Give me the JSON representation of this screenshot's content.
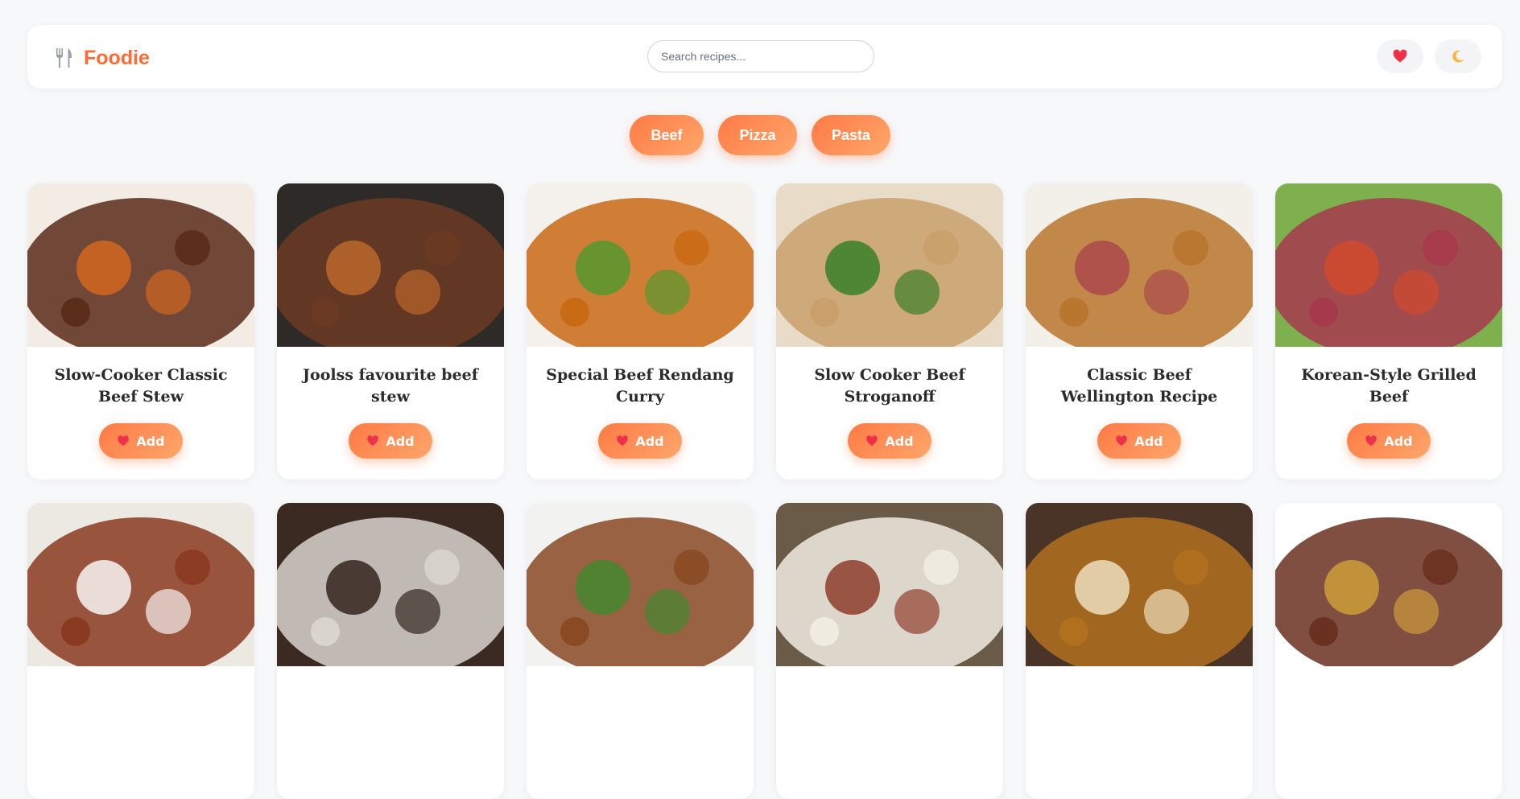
{
  "brand": {
    "name": "Foodie",
    "icon": "fork-knife-icon",
    "color": "#ff6b35"
  },
  "search": {
    "placeholder": "Search recipes..."
  },
  "header_actions": [
    {
      "name": "favorites",
      "icon": "heart-icon",
      "color": "#f0304a"
    },
    {
      "name": "theme-toggle",
      "icon": "moon-icon",
      "color": "#f5b942"
    }
  ],
  "categories": [
    "Beef",
    "Pizza",
    "Pasta"
  ],
  "accent": {
    "gradient_start": "#ff7a45",
    "gradient_end": "#ffa66b",
    "heart": "#f0304a"
  },
  "add_label": "Add",
  "recipes": [
    {
      "title": "Slow-Cooker Classic Beef Stew",
      "image": "beef-stew-image",
      "colors": [
        "#f2ece4",
        "#5a2c1a",
        "#d9691e"
      ]
    },
    {
      "title": "Joolss favourite beef stew",
      "image": "beef-stew-pot-image",
      "colors": [
        "#2e2a28",
        "#6b3a22",
        "#c26a2c"
      ]
    },
    {
      "title": "Special Beef Rendang Curry",
      "image": "rendang-curry-image",
      "colors": [
        "#f4f1ec",
        "#c96a15",
        "#4d9a2e"
      ]
    },
    {
      "title": "Slow Cooker Beef Stroganoff",
      "image": "stroganoff-image",
      "colors": [
        "#e8dcc8",
        "#c9a06b",
        "#2f7d22"
      ]
    },
    {
      "title": "Classic Beef Wellington Recipe",
      "image": "beef-wellington-image",
      "colors": [
        "#f3f0ea",
        "#b8762e",
        "#a9454b"
      ]
    },
    {
      "title": "Korean-Style Grilled Beef",
      "image": "grilled-beef-image",
      "colors": [
        "#7fb04e",
        "#a63a4d",
        "#d44a2a"
      ]
    },
    {
      "title": "",
      "image": "bowl-stew-image",
      "colors": [
        "#ece8e2",
        "#8a3a20",
        "#ffffff"
      ]
    },
    {
      "title": "",
      "image": "stew-bowls-image",
      "colors": [
        "#3a2a22",
        "#d9d4ce",
        "#2a1a14"
      ]
    },
    {
      "title": "",
      "image": "beef-noodles-image",
      "colors": [
        "#f2f2f0",
        "#8a4a24",
        "#3e8a2e"
      ]
    },
    {
      "title": "",
      "image": "beef-bowl-image",
      "colors": [
        "#6a5a48",
        "#f1ece2",
        "#8a3320"
      ]
    },
    {
      "title": "",
      "image": "cheesy-beef-image",
      "colors": [
        "#4a3428",
        "#b0701e",
        "#f2e6c8"
      ]
    },
    {
      "title": "",
      "image": "dutch-oven-stew-image",
      "colors": [
        "#ffffff",
        "#6a3020",
        "#d2a23a"
      ]
    }
  ]
}
